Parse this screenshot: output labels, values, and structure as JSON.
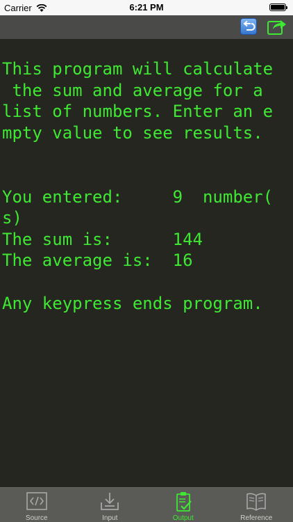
{
  "status_bar": {
    "carrier": "Carrier",
    "time": "6:21 PM"
  },
  "toolbar": {
    "undo_icon": "undo-arrow-icon",
    "share_icon": "share-export-icon"
  },
  "console": {
    "text_color": "#3ee833",
    "background": "#262621",
    "lines": [
      "This program will calculate",
      " the sum and average for a",
      "list of numbers. Enter an e",
      "mpty value to see results.",
      "",
      "",
      "You entered:     9  number(",
      "s)",
      "The sum is:      144",
      "The average is:  16",
      "",
      "Any keypress ends program."
    ]
  },
  "tabs": [
    {
      "label": "Source",
      "icon": "source-code-icon",
      "active": false
    },
    {
      "label": "Input",
      "icon": "input-download-icon",
      "active": false
    },
    {
      "label": "Output",
      "icon": "output-clipboard-icon",
      "active": true
    },
    {
      "label": "Reference",
      "icon": "book-icon",
      "active": false
    }
  ]
}
